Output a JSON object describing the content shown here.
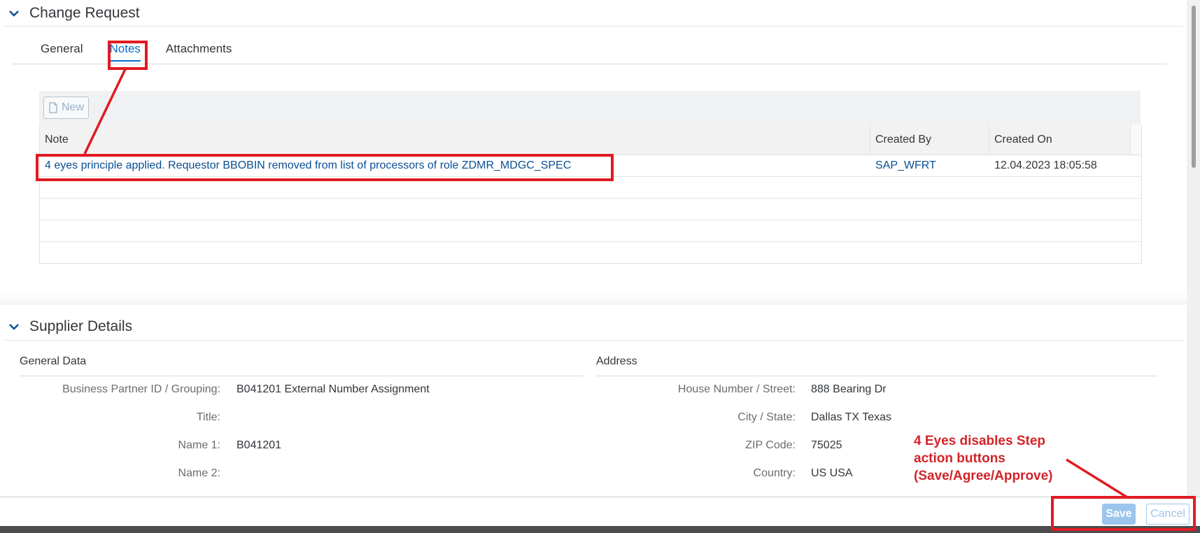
{
  "change_request": {
    "title": "Change Request",
    "tabs": [
      {
        "label": "General"
      },
      {
        "label": "Notes"
      },
      {
        "label": "Attachments"
      }
    ],
    "new_button": "New",
    "table": {
      "columns": [
        "Note",
        "Created By",
        "Created On"
      ],
      "rows": [
        {
          "note": "4 eyes principle applied. Requestor BBOBIN removed from list of processors of role ZDMR_MDGC_SPEC",
          "created_by": "SAP_WFRT",
          "created_on": "12.04.2023 18:05:58"
        }
      ]
    }
  },
  "supplier_details": {
    "title": "Supplier Details",
    "general_data": {
      "title": "General Data",
      "fields": [
        {
          "label": "Business Partner ID / Grouping:",
          "value": "B041201 External Number Assignment"
        },
        {
          "label": "Title:",
          "value": ""
        },
        {
          "label": "Name 1:",
          "value": "B041201"
        },
        {
          "label": "Name 2:",
          "value": ""
        }
      ]
    },
    "address": {
      "title": "Address",
      "fields": [
        {
          "label": "House Number / Street:",
          "value": "888 Bearing Dr"
        },
        {
          "label": "City / State:",
          "value": "Dallas TX Texas"
        },
        {
          "label": "ZIP Code:",
          "value": "75025"
        },
        {
          "label": "Country:",
          "value": "US USA"
        }
      ]
    }
  },
  "footer": {
    "save": "Save",
    "cancel": "Cancel"
  },
  "annotation": {
    "text": "4 Eyes disables Step\naction buttons\n(Save/Agree/Approve)",
    "color": "#e11a22"
  },
  "colors": {
    "link": "#0a4f94",
    "accent": "#0a6ed1",
    "disabled_button": "#9cc5ee"
  }
}
